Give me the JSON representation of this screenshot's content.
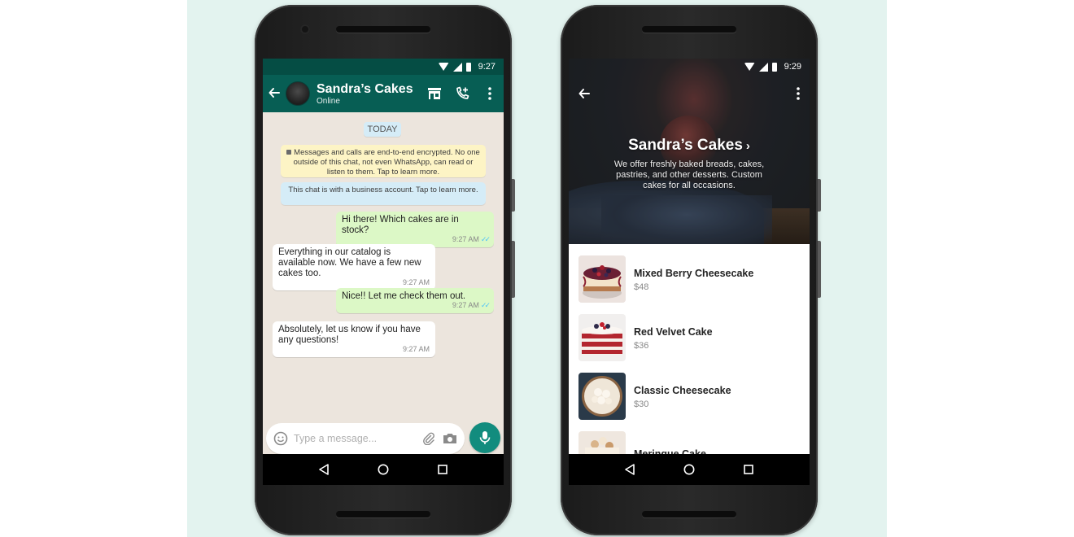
{
  "chat": {
    "status_time": "9:27",
    "contact_name": "Sandra’s Cakes",
    "contact_status": "Online",
    "date_label": "TODAY",
    "encryption_notice": "Messages and calls are end-to-end encrypted. No one outside of this chat, not even WhatsApp, can read or listen to them. Tap to learn more.",
    "business_notice": "This chat is with a business account. Tap to learn more.",
    "messages": [
      {
        "direction": "out",
        "text": "Hi there! Which cakes are in stock?",
        "time": "9:27 AM",
        "read": true
      },
      {
        "direction": "in",
        "text": "Everything in our catalog is available now. We have a few new cakes too.",
        "time": "9:27 AM"
      },
      {
        "direction": "out",
        "text": "Nice!! Let me check them out.",
        "time": "9:27 AM",
        "read": true
      },
      {
        "direction": "in",
        "text": "Absolutely, let us know if you have any questions!",
        "time": "9:27 AM"
      }
    ],
    "composer_placeholder": "Type a message...",
    "icons": [
      "back-arrow",
      "storefront",
      "add-call",
      "more-vertical",
      "emoji",
      "attachment",
      "camera",
      "microphone"
    ]
  },
  "catalog": {
    "status_time": "9:29",
    "business_name": "Sandra’s Cakes",
    "description": "We offer freshly baked breads, cakes, pastries, and other desserts. Custom cakes for all occasions.",
    "items": [
      {
        "name": "Mixed Berry Cheesecake",
        "price": "$48"
      },
      {
        "name": "Red Velvet Cake",
        "price": "$36"
      },
      {
        "name": "Classic Cheesecake",
        "price": "$30"
      },
      {
        "name": "Meringue Cake",
        "price": ""
      }
    ]
  },
  "colors": {
    "whatsapp_header": "#075e54",
    "outgoing_bubble": "#dcf8c6",
    "chat_background": "#ece5dd",
    "mic_button": "#128c7e",
    "read_ticks": "#4fc3f7",
    "page_backdrop": "#e3f3ef"
  }
}
